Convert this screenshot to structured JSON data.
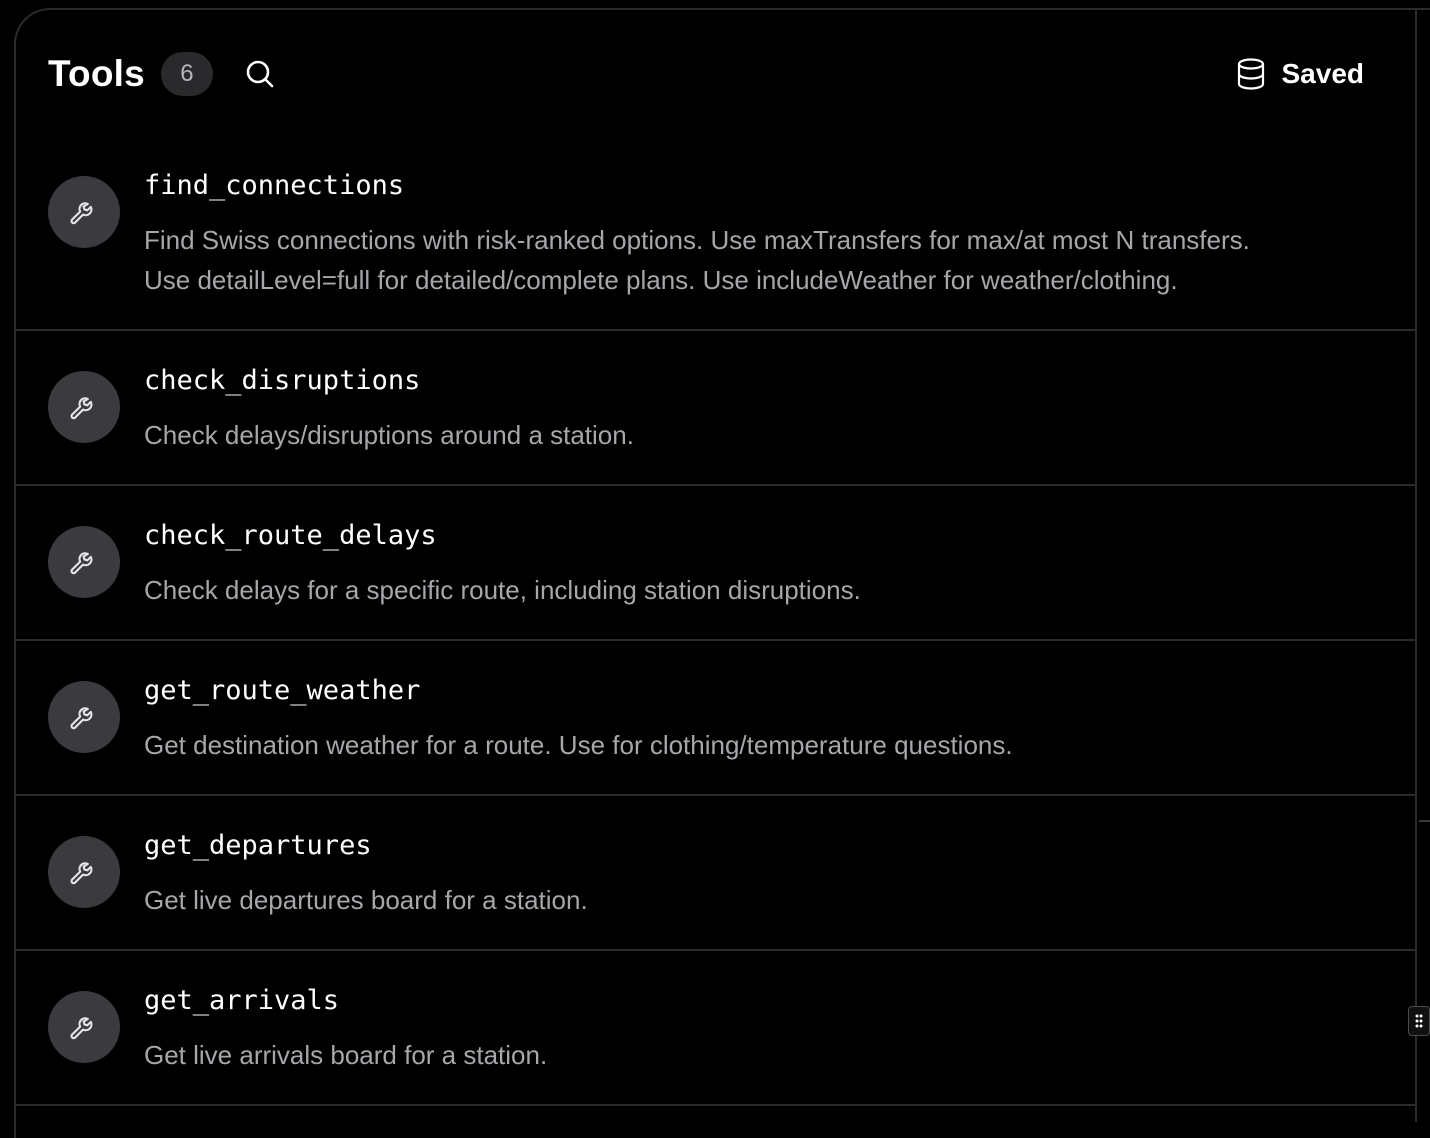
{
  "header": {
    "title": "Tools",
    "count": "6",
    "saved_label": "Saved"
  },
  "tools": [
    {
      "name": "find_connections",
      "description_lines": [
        "Find Swiss connections with risk-ranked options. Use maxTransfers for max/at most N transfers.",
        "Use detailLevel=full for detailed/complete plans. Use includeWeather for weather/clothing."
      ]
    },
    {
      "name": "check_disruptions",
      "description_lines": [
        "Check delays/disruptions around a station."
      ]
    },
    {
      "name": "check_route_delays",
      "description_lines": [
        "Check delays for a specific route, including station disruptions."
      ]
    },
    {
      "name": "get_route_weather",
      "description_lines": [
        "Get destination weather for a route. Use for clothing/temperature questions."
      ]
    },
    {
      "name": "get_departures",
      "description_lines": [
        "Get live departures board for a station."
      ]
    },
    {
      "name": "get_arrivals",
      "description_lines": [
        "Get live arrivals board for a station."
      ]
    }
  ],
  "icons": {
    "search": "search-icon",
    "saved": "database-icon",
    "tool": "wrench-icon",
    "handle": "drag-handle-icon"
  },
  "colors": {
    "background": "#000000",
    "divider": "#2b2b2b",
    "icon_circle": "#3a3a3f",
    "badge": "#2a2a2c",
    "description_text": "#a6a6ab"
  }
}
